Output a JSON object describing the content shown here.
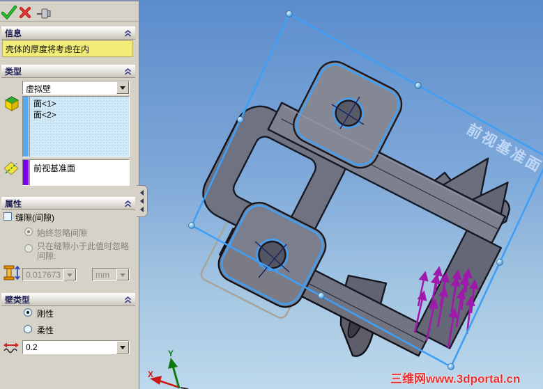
{
  "panel": {
    "toolbar": {
      "ok_icon": "ok-checkmark",
      "cancel_icon": "cancel-x",
      "pin_icon": "pushpin"
    },
    "info": {
      "title": "信息",
      "message": "壳体的厚度将考虑在内"
    },
    "type": {
      "title": "类型",
      "selected_type": "虚拟壁",
      "faces": [
        "面<1>",
        "面<2>"
      ],
      "bounding_plane": "前视基准面"
    },
    "properties": {
      "title": "属性",
      "gap_label": "缝隙(间隙)",
      "gap_checked": false,
      "option_always": "始终忽略间隙",
      "option_threshold": "只在缝隙小于此值时忽略间隙:",
      "selected_option": "始终忽略间隙",
      "gap_value": "0.017673",
      "gap_unit": "mm"
    },
    "wall": {
      "title": "壁类型",
      "option_rigid": "刚性",
      "option_flexible": "柔性",
      "selected_option": "刚性",
      "thickness_value": "0.2"
    }
  },
  "viewport": {
    "plane_label": "前视基准面",
    "watermark": "三维网www.3dportal.cn",
    "triad": {
      "x": "X",
      "y": "Y"
    },
    "colors": {
      "selection_blue": "#3f9ff5",
      "load_arrows": "#a010a8",
      "background_top": "#5b8ccb",
      "background_bottom": "#bcd8ec"
    }
  }
}
